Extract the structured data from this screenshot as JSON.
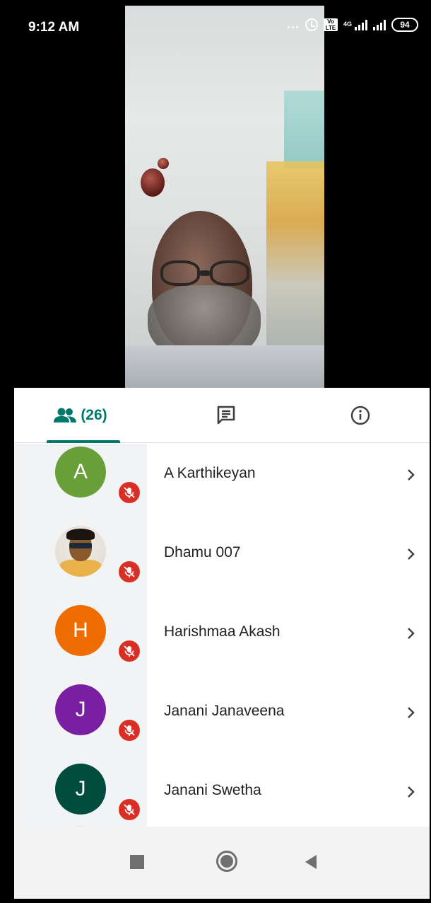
{
  "status_bar": {
    "time": "9:12 AM",
    "overflow": "...",
    "volte": "Vo LTE",
    "network": "4G",
    "battery": "94",
    "icons": [
      "alarm-icon",
      "volte-icon",
      "signal-icon",
      "signal-icon",
      "battery-icon"
    ]
  },
  "tabs": {
    "people_count": "(26)",
    "people_icon": "people-icon",
    "chat_icon": "chat-icon",
    "info_icon": "info-icon",
    "accent_color": "#00796b"
  },
  "participants": [
    {
      "initial": "A",
      "name": "A Karthikeyan",
      "color": "#689f38",
      "muted": true
    },
    {
      "initial": "",
      "name": "Dhamu 007",
      "color": "",
      "photo": true,
      "muted": true
    },
    {
      "initial": "H",
      "name": "Harishmaa Akash",
      "color": "#ef6c00",
      "muted": true
    },
    {
      "initial": "J",
      "name": "Janani Janaveena",
      "color": "#7b1fa2",
      "muted": true
    },
    {
      "initial": "J",
      "name": "Janani Swetha",
      "color": "#004d40",
      "muted": true
    }
  ],
  "colors": {
    "mute_badge": "#d93025",
    "list_strip": "#f1f3f4"
  },
  "navbar": {
    "icons": [
      "recents-icon",
      "home-icon",
      "back-icon"
    ]
  }
}
